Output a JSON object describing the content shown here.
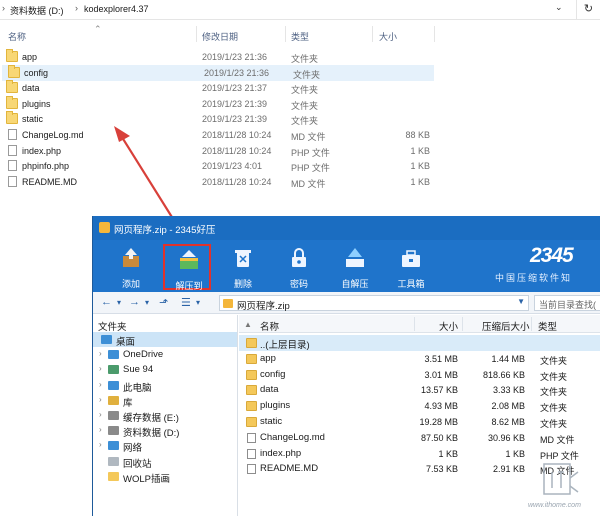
{
  "explorer": {
    "breadcrumb": [
      "资料数据 (D:)",
      "kodexplorer4.37"
    ],
    "columns": {
      "name": "名称",
      "date": "修改日期",
      "type": "类型",
      "size": "大小"
    },
    "files": [
      {
        "name": "app",
        "date": "2019/1/23 21:36",
        "type": "文件夹",
        "size": "",
        "kind": "folder"
      },
      {
        "name": "config",
        "date": "2019/1/23 21:36",
        "type": "文件夹",
        "size": "",
        "kind": "folder"
      },
      {
        "name": "data",
        "date": "2019/1/23 21:37",
        "type": "文件夹",
        "size": "",
        "kind": "folder"
      },
      {
        "name": "plugins",
        "date": "2019/1/23 21:39",
        "type": "文件夹",
        "size": "",
        "kind": "folder"
      },
      {
        "name": "static",
        "date": "2019/1/23 21:39",
        "type": "文件夹",
        "size": "",
        "kind": "folder"
      },
      {
        "name": "ChangeLog.md",
        "date": "2018/11/28 10:24",
        "type": "MD 文件",
        "size": "88 KB",
        "kind": "file"
      },
      {
        "name": "index.php",
        "date": "2018/11/28 10:24",
        "type": "PHP 文件",
        "size": "1 KB",
        "kind": "file"
      },
      {
        "name": "phpinfo.php",
        "date": "2019/1/23 4:01",
        "type": "PHP 文件",
        "size": "1 KB",
        "kind": "file"
      },
      {
        "name": "README.MD",
        "date": "2018/11/28 10:24",
        "type": "MD 文件",
        "size": "1 KB",
        "kind": "file"
      }
    ]
  },
  "haozip": {
    "title": "网页程序.zip - 2345好压",
    "brand": "2345",
    "slogan": "中国压缩软件知",
    "toolbar": [
      {
        "label": "添加",
        "icon": "add-icon"
      },
      {
        "label": "解压到",
        "icon": "extract-icon",
        "active": true
      },
      {
        "label": "删除",
        "icon": "delete-icon"
      },
      {
        "label": "密码",
        "icon": "lock-icon"
      },
      {
        "label": "自解压",
        "icon": "self-extract-icon"
      },
      {
        "label": "工具箱",
        "icon": "toolbox-icon"
      }
    ],
    "path": "网页程序.zip",
    "search_placeholder": "当前目录查找(",
    "tree_header": "文件夹",
    "tree": [
      {
        "label": "桌面",
        "icon": "desktop-icon",
        "selected": true,
        "arrow": ""
      },
      {
        "label": "OneDrive",
        "icon": "cloud-icon",
        "arrow": "›"
      },
      {
        "label": "Sue 94",
        "icon": "user-icon",
        "arrow": "›"
      },
      {
        "label": "此电脑",
        "icon": "computer-icon",
        "arrow": "›"
      },
      {
        "label": "库",
        "icon": "library-icon",
        "arrow": "›"
      },
      {
        "label": "缓存数据 (E:)",
        "icon": "drive-icon",
        "arrow": "›"
      },
      {
        "label": "资料数据 (D:)",
        "icon": "drive-icon",
        "arrow": "›"
      },
      {
        "label": "网络",
        "icon": "network-icon",
        "arrow": "›"
      },
      {
        "label": "回收站",
        "icon": "recycle-bin-icon",
        "arrow": ""
      },
      {
        "label": "WOLP插画",
        "icon": "folder-icon",
        "arrow": ""
      }
    ],
    "columns": {
      "name": "名称",
      "size": "大小",
      "compressed": "压缩后大小",
      "type": "类型"
    },
    "rows": [
      {
        "name": "..(上层目录)",
        "size": "",
        "compressed": "",
        "type": "",
        "kind": "folder",
        "selected": true
      },
      {
        "name": "app",
        "size": "3.51 MB",
        "compressed": "1.44 MB",
        "type": "文件夹",
        "kind": "folder"
      },
      {
        "name": "config",
        "size": "3.01 MB",
        "compressed": "818.66 KB",
        "type": "文件夹",
        "kind": "folder"
      },
      {
        "name": "data",
        "size": "13.57 KB",
        "compressed": "3.33 KB",
        "type": "文件夹",
        "kind": "folder"
      },
      {
        "name": "plugins",
        "size": "4.93 MB",
        "compressed": "2.08 MB",
        "type": "文件夹",
        "kind": "folder"
      },
      {
        "name": "static",
        "size": "19.28 MB",
        "compressed": "8.62 MB",
        "type": "文件夹",
        "kind": "folder"
      },
      {
        "name": "ChangeLog.md",
        "size": "87.50 KB",
        "compressed": "30.96 KB",
        "type": "MD 文件",
        "kind": "file"
      },
      {
        "name": "index.php",
        "size": "1 KB",
        "compressed": "1 KB",
        "type": "PHP 文件",
        "kind": "file"
      },
      {
        "name": "README.MD",
        "size": "7.53 KB",
        "compressed": "2.91 KB",
        "type": "MD 文件",
        "kind": "file"
      }
    ]
  },
  "watermark": "www.ithome.com",
  "colors": {
    "titlebar": "#1b6dc1",
    "toolbar": "#1f74cb",
    "highlight": "#e2322b",
    "folder": "#f4c85a"
  }
}
